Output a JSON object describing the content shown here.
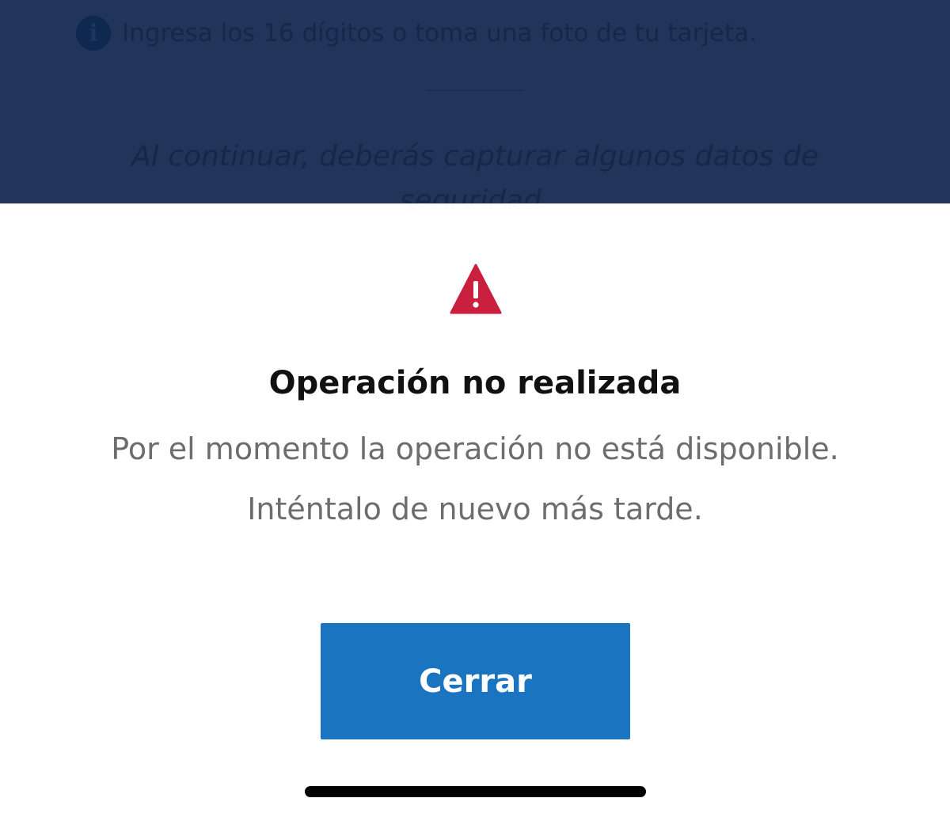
{
  "background_page": {
    "info_icon": "info-circle-icon",
    "info_text": "Ingresa los 16 dígitos o toma una foto de tu tarjeta.",
    "notice_line1": "Al continuar, deberás capturar algunos datos de",
    "notice_line2": "seguridad."
  },
  "dialog": {
    "icon": "warning-triangle-icon",
    "title": "Operación no realizada",
    "message_line1": "Por el momento la operación no está disponible.",
    "message_line2": "Inténtalo de nuevo más tarde.",
    "close_label": "Cerrar"
  },
  "colors": {
    "backdrop": "#21355a",
    "warning": "#c8203e",
    "button": "#1b74bf"
  }
}
